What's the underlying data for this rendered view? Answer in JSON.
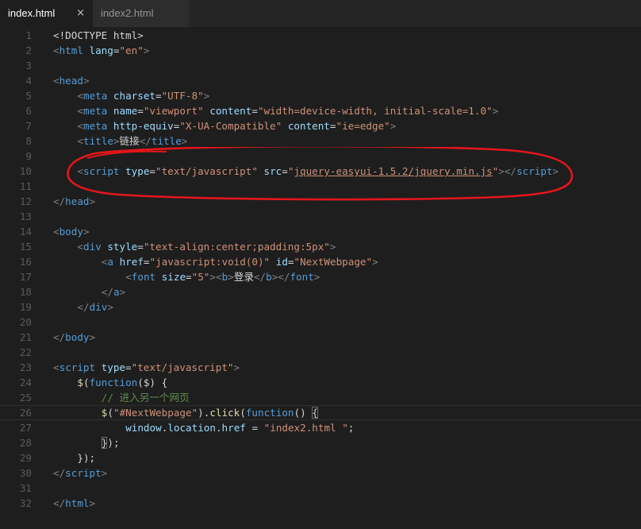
{
  "tabs": [
    {
      "label": "index.html",
      "close": "×"
    },
    {
      "label": "index2.html"
    }
  ],
  "lines": [
    {
      "n": "1",
      "tokens": [
        {
          "t": "<!DOCTYPE html>",
          "c": "x"
        }
      ]
    },
    {
      "n": "2",
      "tokens": [
        {
          "t": "<",
          "c": "p"
        },
        {
          "t": "html",
          "c": "t"
        },
        {
          "t": " lang",
          "c": "a"
        },
        {
          "t": "=",
          "c": "x"
        },
        {
          "t": "\"en\"",
          "c": "s"
        },
        {
          "t": ">",
          "c": "p"
        }
      ]
    },
    {
      "n": "3",
      "tokens": []
    },
    {
      "n": "4",
      "tokens": [
        {
          "t": "<",
          "c": "p"
        },
        {
          "t": "head",
          "c": "t"
        },
        {
          "t": ">",
          "c": "p"
        }
      ]
    },
    {
      "n": "5",
      "indent": 1,
      "tokens": [
        {
          "t": "<",
          "c": "p"
        },
        {
          "t": "meta",
          "c": "t"
        },
        {
          "t": " charset",
          "c": "a"
        },
        {
          "t": "=",
          "c": "x"
        },
        {
          "t": "\"UTF-8\"",
          "c": "s"
        },
        {
          "t": ">",
          "c": "p"
        }
      ]
    },
    {
      "n": "6",
      "indent": 1,
      "tokens": [
        {
          "t": "<",
          "c": "p"
        },
        {
          "t": "meta",
          "c": "t"
        },
        {
          "t": " name",
          "c": "a"
        },
        {
          "t": "=",
          "c": "x"
        },
        {
          "t": "\"viewport\"",
          "c": "s"
        },
        {
          "t": " content",
          "c": "a"
        },
        {
          "t": "=",
          "c": "x"
        },
        {
          "t": "\"width=device-width, initial-scale=1.0\"",
          "c": "s"
        },
        {
          "t": ">",
          "c": "p"
        }
      ]
    },
    {
      "n": "7",
      "indent": 1,
      "tokens": [
        {
          "t": "<",
          "c": "p"
        },
        {
          "t": "meta",
          "c": "t"
        },
        {
          "t": " http-equiv",
          "c": "a"
        },
        {
          "t": "=",
          "c": "x"
        },
        {
          "t": "\"X-UA-Compatible\"",
          "c": "s"
        },
        {
          "t": " content",
          "c": "a"
        },
        {
          "t": "=",
          "c": "x"
        },
        {
          "t": "\"ie=edge\"",
          "c": "s"
        },
        {
          "t": ">",
          "c": "p"
        }
      ]
    },
    {
      "n": "8",
      "indent": 1,
      "tokens": [
        {
          "t": "<",
          "c": "p"
        },
        {
          "t": "title",
          "c": "t"
        },
        {
          "t": ">",
          "c": "p"
        },
        {
          "t": "链接",
          "c": "x"
        },
        {
          "t": "</",
          "c": "p"
        },
        {
          "t": "title",
          "c": "t"
        },
        {
          "t": ">",
          "c": "p"
        }
      ]
    },
    {
      "n": "9",
      "tokens": []
    },
    {
      "n": "10",
      "indent": 1,
      "tokens": [
        {
          "t": "<",
          "c": "p"
        },
        {
          "t": "script",
          "c": "t"
        },
        {
          "t": " type",
          "c": "a"
        },
        {
          "t": "=",
          "c": "x"
        },
        {
          "t": "\"text/javascript\"",
          "c": "s"
        },
        {
          "t": " src",
          "c": "a"
        },
        {
          "t": "=",
          "c": "x"
        },
        {
          "t": "\"",
          "c": "s"
        },
        {
          "t": "jquery-easyui-1.5.2/jquery.min.js",
          "c": "s",
          "u": true
        },
        {
          "t": "\"",
          "c": "s"
        },
        {
          "t": "></",
          "c": "p"
        },
        {
          "t": "script",
          "c": "t"
        },
        {
          "t": ">",
          "c": "p"
        }
      ]
    },
    {
      "n": "11",
      "tokens": []
    },
    {
      "n": "12",
      "tokens": [
        {
          "t": "</",
          "c": "p"
        },
        {
          "t": "head",
          "c": "t"
        },
        {
          "t": ">",
          "c": "p"
        }
      ]
    },
    {
      "n": "13",
      "tokens": []
    },
    {
      "n": "14",
      "tokens": [
        {
          "t": "<",
          "c": "p"
        },
        {
          "t": "body",
          "c": "t"
        },
        {
          "t": ">",
          "c": "p"
        }
      ]
    },
    {
      "n": "15",
      "indent": 1,
      "tokens": [
        {
          "t": "<",
          "c": "p"
        },
        {
          "t": "div",
          "c": "t"
        },
        {
          "t": " style",
          "c": "a"
        },
        {
          "t": "=",
          "c": "x"
        },
        {
          "t": "\"text-align:center;padding:5px\"",
          "c": "s"
        },
        {
          "t": ">",
          "c": "p"
        }
      ]
    },
    {
      "n": "16",
      "indent": 2,
      "tokens": [
        {
          "t": "<",
          "c": "p"
        },
        {
          "t": "a",
          "c": "t"
        },
        {
          "t": " href",
          "c": "a"
        },
        {
          "t": "=",
          "c": "x"
        },
        {
          "t": "\"javascript:void(0)\"",
          "c": "s"
        },
        {
          "t": " id",
          "c": "a"
        },
        {
          "t": "=",
          "c": "x"
        },
        {
          "t": "\"NextWebpage\"",
          "c": "s"
        },
        {
          "t": ">",
          "c": "p"
        }
      ]
    },
    {
      "n": "17",
      "indent": 3,
      "tokens": [
        {
          "t": "<",
          "c": "p"
        },
        {
          "t": "font",
          "c": "t"
        },
        {
          "t": " size",
          "c": "a"
        },
        {
          "t": "=",
          "c": "x"
        },
        {
          "t": "\"5\"",
          "c": "s"
        },
        {
          "t": "><",
          "c": "p"
        },
        {
          "t": "b",
          "c": "t"
        },
        {
          "t": ">",
          "c": "p"
        },
        {
          "t": "登录",
          "c": "x"
        },
        {
          "t": "</",
          "c": "p"
        },
        {
          "t": "b",
          "c": "t"
        },
        {
          "t": "></",
          "c": "p"
        },
        {
          "t": "font",
          "c": "t"
        },
        {
          "t": ">",
          "c": "p"
        }
      ]
    },
    {
      "n": "18",
      "indent": 2,
      "tokens": [
        {
          "t": "</",
          "c": "p"
        },
        {
          "t": "a",
          "c": "t"
        },
        {
          "t": ">",
          "c": "p"
        }
      ]
    },
    {
      "n": "19",
      "indent": 1,
      "tokens": [
        {
          "t": "</",
          "c": "p"
        },
        {
          "t": "div",
          "c": "t"
        },
        {
          "t": ">",
          "c": "p"
        }
      ]
    },
    {
      "n": "20",
      "tokens": []
    },
    {
      "n": "21",
      "tokens": [
        {
          "t": "</",
          "c": "p"
        },
        {
          "t": "body",
          "c": "t"
        },
        {
          "t": ">",
          "c": "p"
        }
      ]
    },
    {
      "n": "22",
      "tokens": []
    },
    {
      "n": "23",
      "tokens": [
        {
          "t": "<",
          "c": "p"
        },
        {
          "t": "script",
          "c": "t"
        },
        {
          "t": " type",
          "c": "a"
        },
        {
          "t": "=",
          "c": "x"
        },
        {
          "t": "\"text/javascript\"",
          "c": "s"
        },
        {
          "t": ">",
          "c": "p"
        }
      ]
    },
    {
      "n": "24",
      "indent": 1,
      "tokens": [
        {
          "t": "$",
          "c": "f"
        },
        {
          "t": "(",
          "c": "x"
        },
        {
          "t": "function",
          "c": "k"
        },
        {
          "t": "($) {",
          "c": "x"
        }
      ]
    },
    {
      "n": "25",
      "indent": 2,
      "tokens": [
        {
          "t": "// 进入另一个网页",
          "c": "c"
        }
      ]
    },
    {
      "n": "26",
      "indent": 2,
      "current": true,
      "tokens": [
        {
          "t": "$",
          "c": "f"
        },
        {
          "t": "(",
          "c": "x"
        },
        {
          "t": "\"#NextWebpage\"",
          "c": "s"
        },
        {
          "t": ").",
          "c": "x"
        },
        {
          "t": "click",
          "c": "f"
        },
        {
          "t": "(",
          "c": "x"
        },
        {
          "t": "function",
          "c": "k"
        },
        {
          "t": "() ",
          "c": "x"
        },
        {
          "t": "{",
          "c": "x",
          "box": true
        }
      ]
    },
    {
      "n": "27",
      "indent": 3,
      "tokens": [
        {
          "t": "window",
          "c": "a"
        },
        {
          "t": ".",
          "c": "x"
        },
        {
          "t": "location",
          "c": "a"
        },
        {
          "t": ".",
          "c": "x"
        },
        {
          "t": "href",
          "c": "a"
        },
        {
          "t": " = ",
          "c": "x"
        },
        {
          "t": "\"index2.html \"",
          "c": "s"
        },
        {
          "t": ";",
          "c": "x"
        }
      ]
    },
    {
      "n": "28",
      "indent": 2,
      "tokens": [
        {
          "t": "}",
          "c": "x",
          "box": true
        },
        {
          "t": ");",
          "c": "x"
        }
      ]
    },
    {
      "n": "29",
      "indent": 1,
      "tokens": [
        {
          "t": "});",
          "c": "x"
        }
      ]
    },
    {
      "n": "30",
      "tokens": [
        {
          "t": "</",
          "c": "p"
        },
        {
          "t": "script",
          "c": "t"
        },
        {
          "t": ">",
          "c": "p"
        }
      ]
    },
    {
      "n": "31",
      "tokens": []
    },
    {
      "n": "32",
      "tokens": [
        {
          "t": "</",
          "c": "p"
        },
        {
          "t": "html",
          "c": "t"
        },
        {
          "t": ">",
          "c": "p"
        }
      ]
    }
  ],
  "colors": {
    "annotation": "#e3161b",
    "background": "#1e1e1e"
  }
}
